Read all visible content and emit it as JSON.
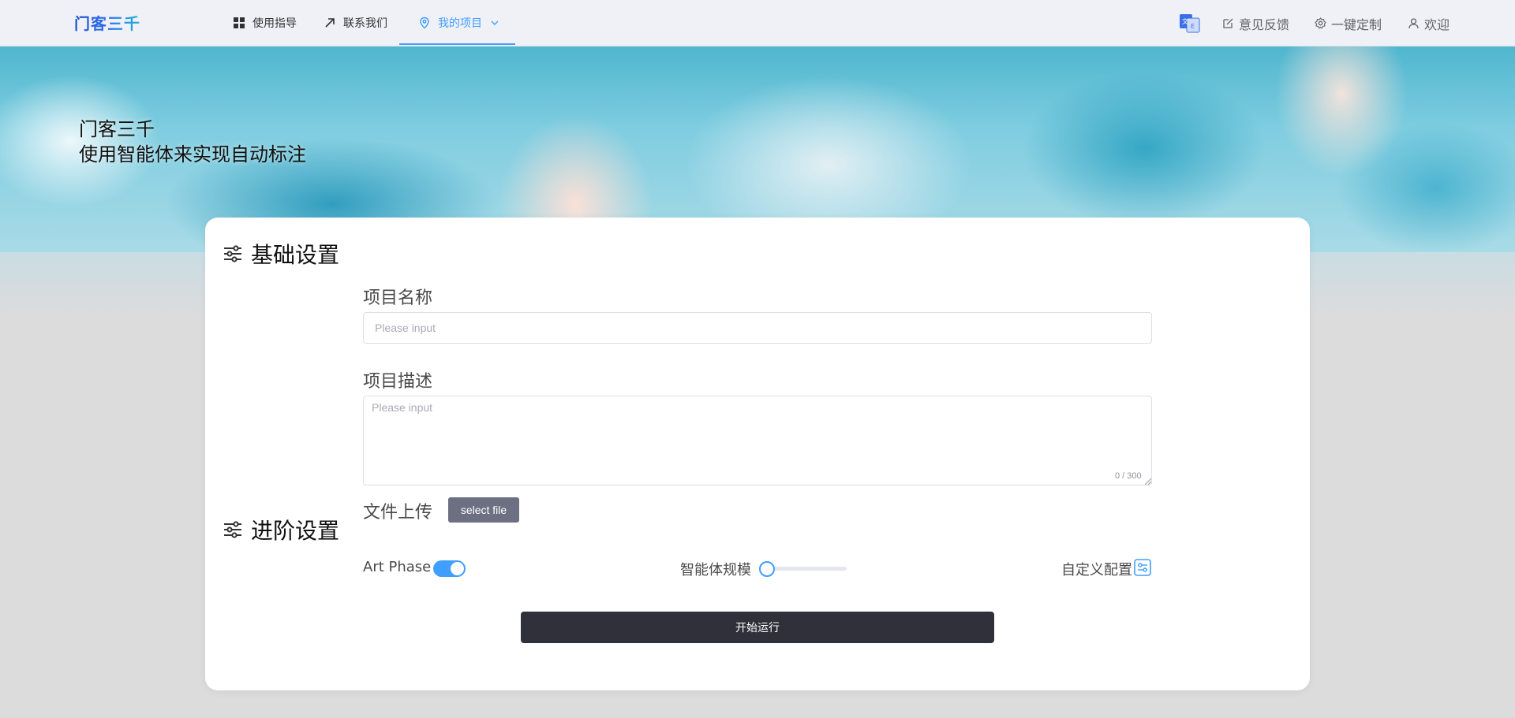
{
  "header": {
    "logo_text": "门客三千",
    "nav": [
      {
        "label": "使用指导",
        "icon": "grid-icon"
      },
      {
        "label": "联系我们",
        "icon": "arrow-up-right-icon"
      },
      {
        "label": "我的项目",
        "icon": "location-pin-icon",
        "active": true
      }
    ],
    "right": {
      "translate_icon": "translate-icon",
      "feedback_label": "意见反馈",
      "customize_label": "一键定制",
      "welcome_label": "欢迎"
    }
  },
  "hero": {
    "title_line1": "门客三千",
    "title_line2": "使用智能体来实现自动标注"
  },
  "basic_settings": {
    "title": "基础设置",
    "project_name_label": "项目名称",
    "project_name_placeholder": "Please input",
    "project_name_value": "",
    "project_desc_label": "项目描述",
    "project_desc_placeholder": "Please input",
    "project_desc_value": "",
    "desc_counter": "0 / 300",
    "file_upload_label": "文件上传",
    "file_button_label": "select file"
  },
  "advanced_settings": {
    "title": "进阶设置",
    "art_phase_label": "Art Phase",
    "art_phase_enabled": true,
    "agent_scale_label": "智能体规模",
    "agent_scale_value": 0,
    "custom_config_label": "自定义配置"
  },
  "run_button_label": "开始运行",
  "colors": {
    "accent": "#409eff",
    "run_button": "#2f3039",
    "file_button": "#6c7082"
  }
}
